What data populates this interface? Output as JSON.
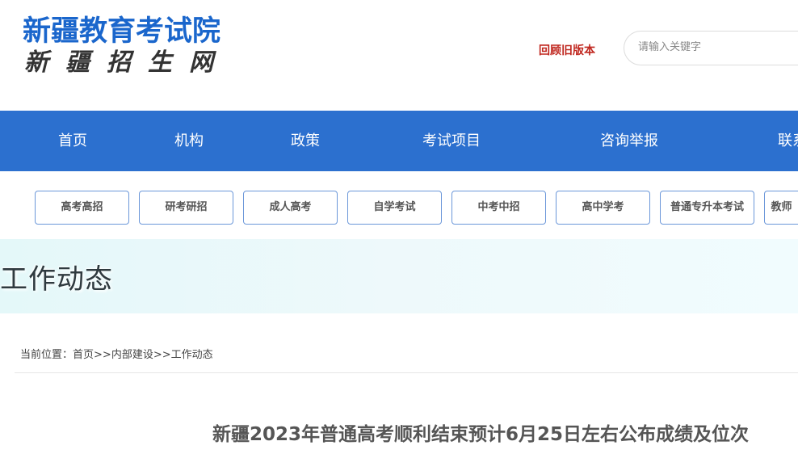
{
  "header": {
    "logo_main": "新疆教育考试院",
    "logo_sub": "新疆招生网",
    "old_version_link": "回顾旧版本",
    "search_placeholder": "请输入关键字"
  },
  "nav": {
    "items": [
      {
        "label": "首页"
      },
      {
        "label": "机构"
      },
      {
        "label": "政策"
      },
      {
        "label": "考试项目"
      },
      {
        "label": "咨询举报"
      },
      {
        "label": "联系"
      }
    ]
  },
  "categories": [
    {
      "label": "高考高招"
    },
    {
      "label": "研考研招"
    },
    {
      "label": "成人高考"
    },
    {
      "label": "自学考试"
    },
    {
      "label": "中考中招"
    },
    {
      "label": "高中学考"
    },
    {
      "label": "普通专升本考试"
    },
    {
      "label": "教师"
    }
  ],
  "banner": {
    "title": "工作动态"
  },
  "breadcrumb": {
    "prefix": "当前位置：",
    "items": [
      "首页",
      "内部建设",
      "工作动态"
    ],
    "separator": ">>"
  },
  "article": {
    "title": "新疆2023年普通高考顺利结束预计6月25日左右公布成绩及位次"
  },
  "colors": {
    "brand_blue": "#2c70cf",
    "logo_blue": "#1a66cc",
    "link_red": "#c0271f"
  }
}
